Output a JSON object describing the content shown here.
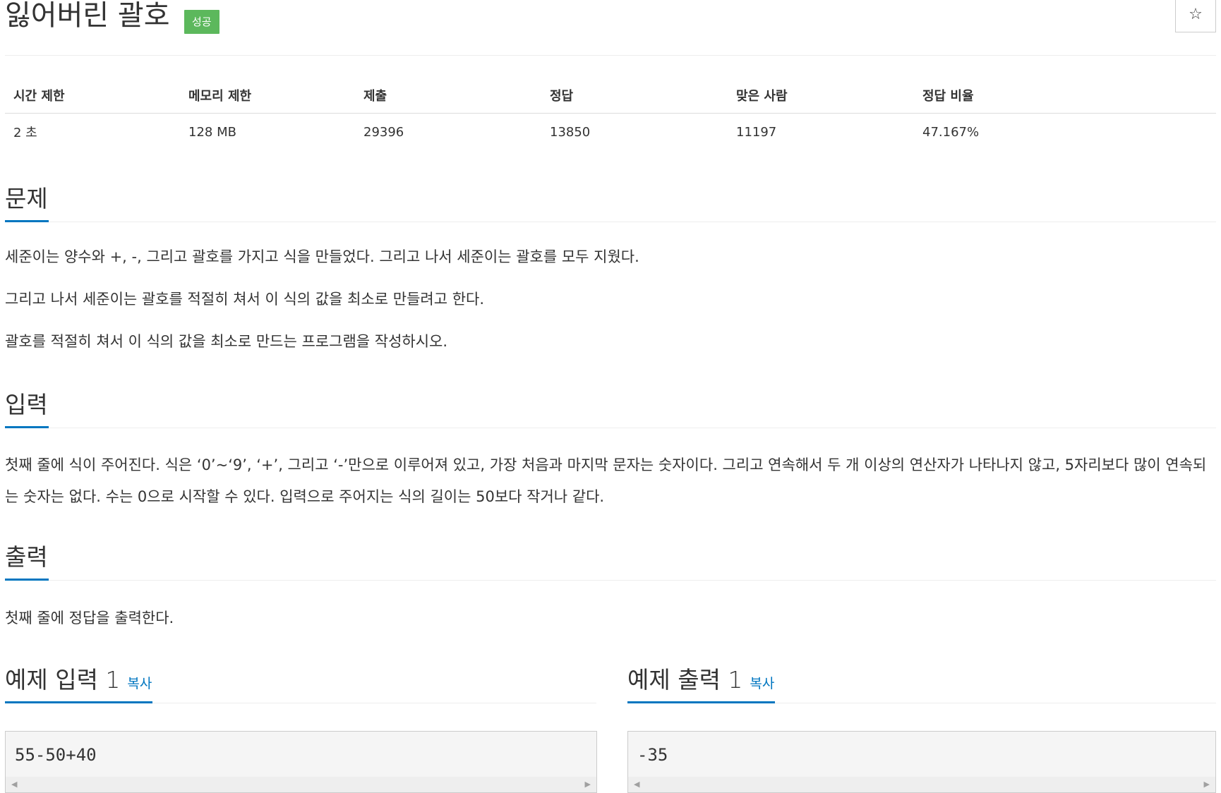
{
  "problem": {
    "title": "잃어버린 괄호",
    "badge": "성공",
    "star_icon": "☆"
  },
  "info_table": {
    "headers": [
      "시간 제한",
      "메모리 제한",
      "제출",
      "정답",
      "맞은 사람",
      "정답 비율"
    ],
    "values": [
      "2 초",
      "128 MB",
      "29396",
      "13850",
      "11197",
      "47.167%"
    ]
  },
  "sections": {
    "description": {
      "title": "문제",
      "paragraphs": [
        "세준이는 양수와 +, -, 그리고 괄호를 가지고 식을 만들었다. 그리고 나서 세준이는 괄호를 모두 지웠다.",
        "그리고 나서 세준이는 괄호를 적절히 쳐서 이 식의 값을 최소로 만들려고 한다.",
        "괄호를 적절히 쳐서 이 식의 값을 최소로 만드는 프로그램을 작성하시오."
      ]
    },
    "input": {
      "title": "입력",
      "text": "첫째 줄에 식이 주어진다. 식은 ‘0’~‘9’, ‘+’, 그리고 ‘-’만으로 이루어져 있고, 가장 처음과 마지막 문자는 숫자이다. 그리고 연속해서 두 개 이상의 연산자가 나타나지 않고, 5자리보다 많이 연속되는 숫자는 없다. 수는 0으로 시작할 수 있다. 입력으로 주어지는 식의 길이는 50보다 작거나 같다."
    },
    "output": {
      "title": "출력",
      "text": "첫째 줄에 정답을 출력한다."
    }
  },
  "samples": {
    "input": {
      "title": "예제 입력 1",
      "copy_label": "복사",
      "code": "55-50+40"
    },
    "output": {
      "title": "예제 출력 1",
      "copy_label": "복사",
      "code": "-35"
    }
  },
  "colors": {
    "accent": "#0076c0",
    "badge_success": "#5cb85c"
  }
}
